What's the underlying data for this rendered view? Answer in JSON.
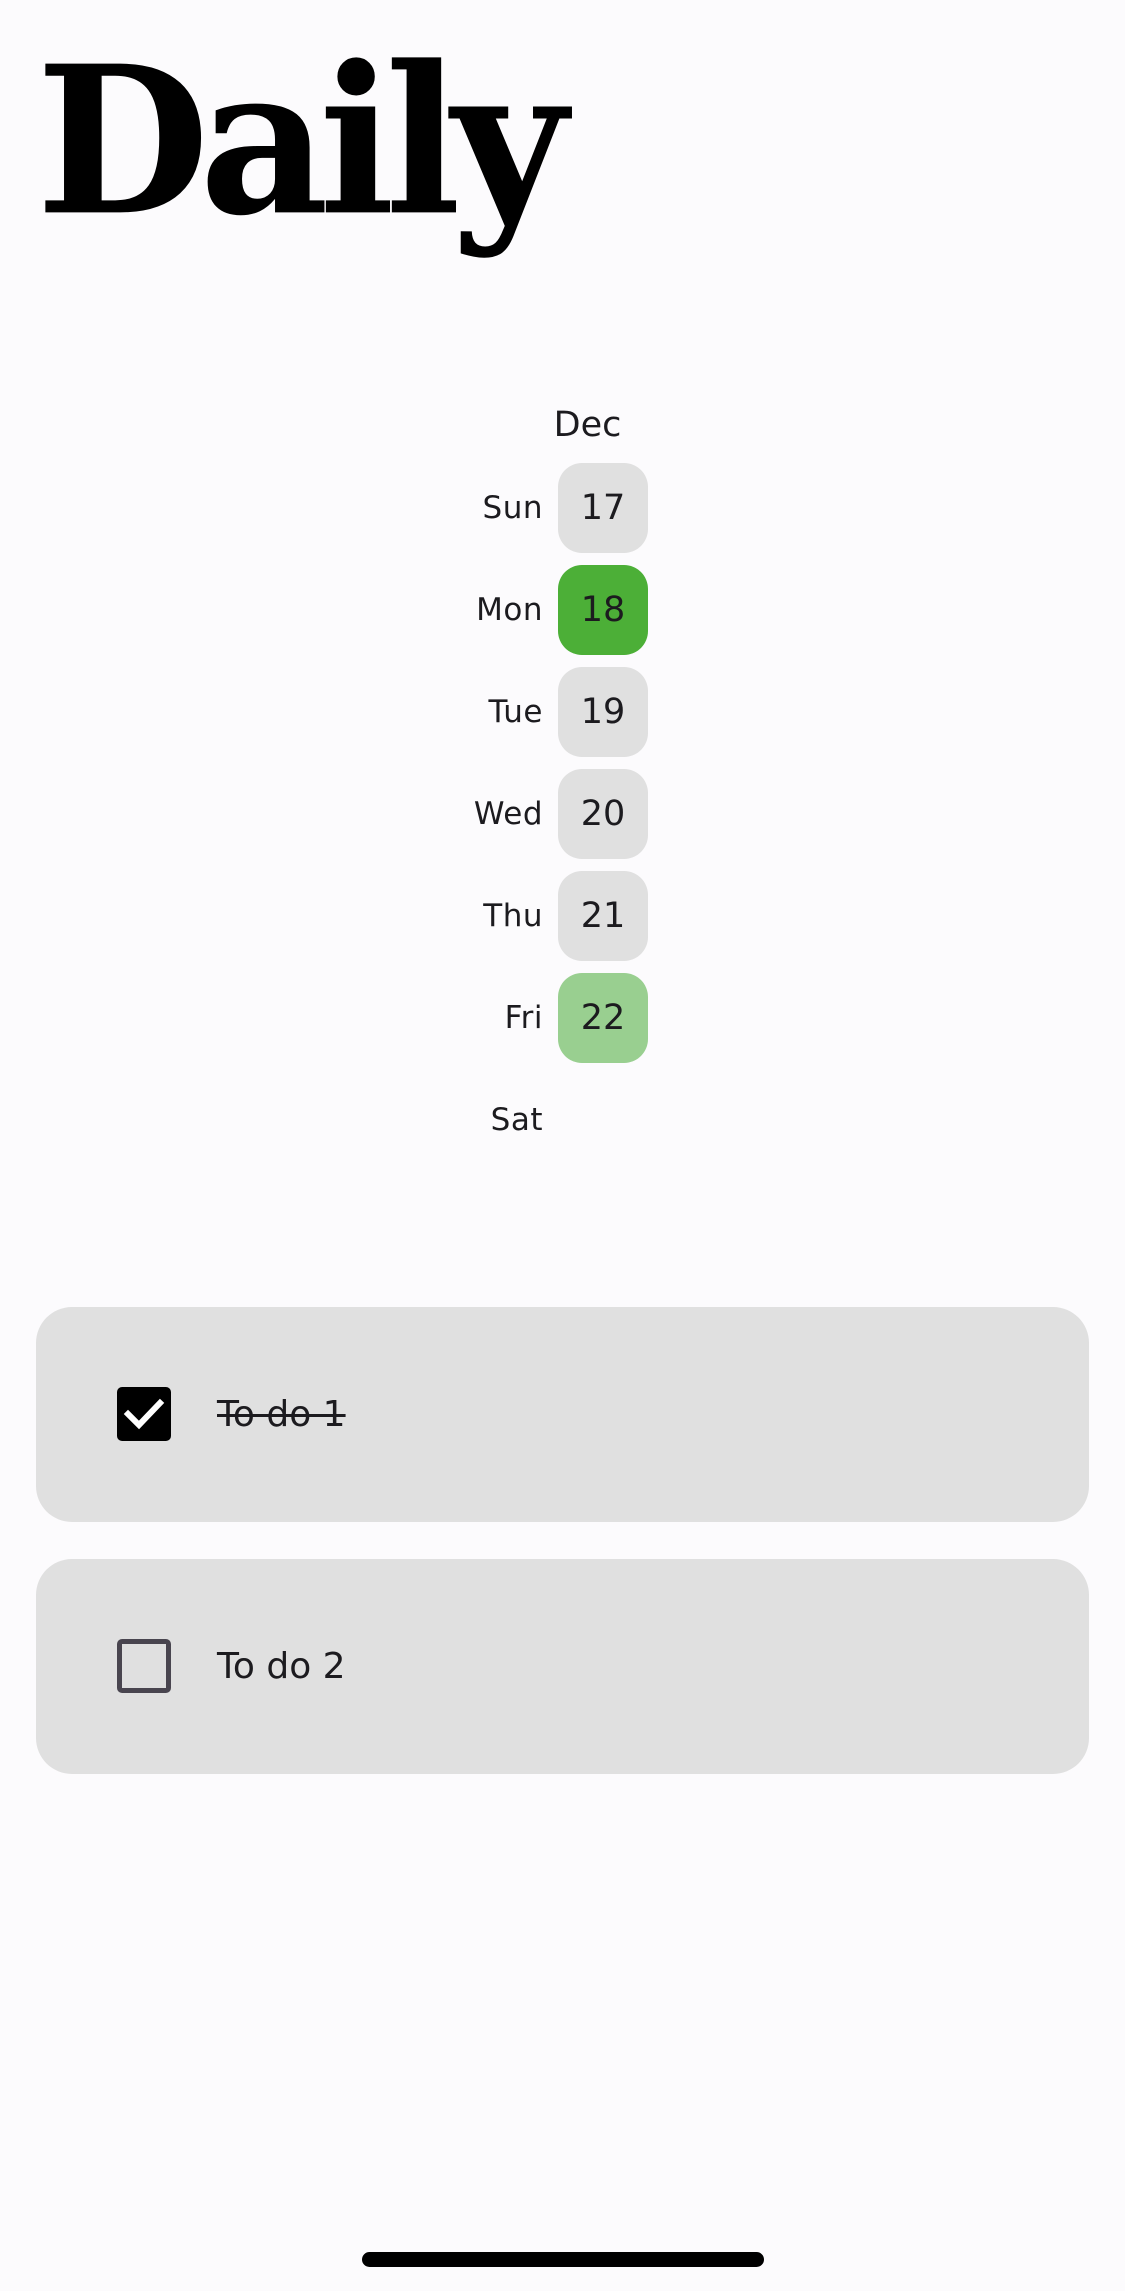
{
  "header": {
    "title": "Daily"
  },
  "calendar": {
    "month": "Dec",
    "days": [
      {
        "weekday": "Sun",
        "date": "17",
        "state": "default"
      },
      {
        "weekday": "Mon",
        "date": "18",
        "state": "selected"
      },
      {
        "weekday": "Tue",
        "date": "19",
        "state": "default"
      },
      {
        "weekday": "Wed",
        "date": "20",
        "state": "default"
      },
      {
        "weekday": "Thu",
        "date": "21",
        "state": "default"
      },
      {
        "weekday": "Fri",
        "date": "22",
        "state": "today"
      },
      {
        "weekday": "Sat",
        "date": "",
        "state": "empty"
      }
    ],
    "colors": {
      "selected": "#4caf37",
      "today": "#99cf90",
      "default": "#e0e0e0"
    }
  },
  "todos": [
    {
      "label": "To do 1",
      "checked": true
    },
    {
      "label": "To do 2",
      "checked": false
    }
  ]
}
